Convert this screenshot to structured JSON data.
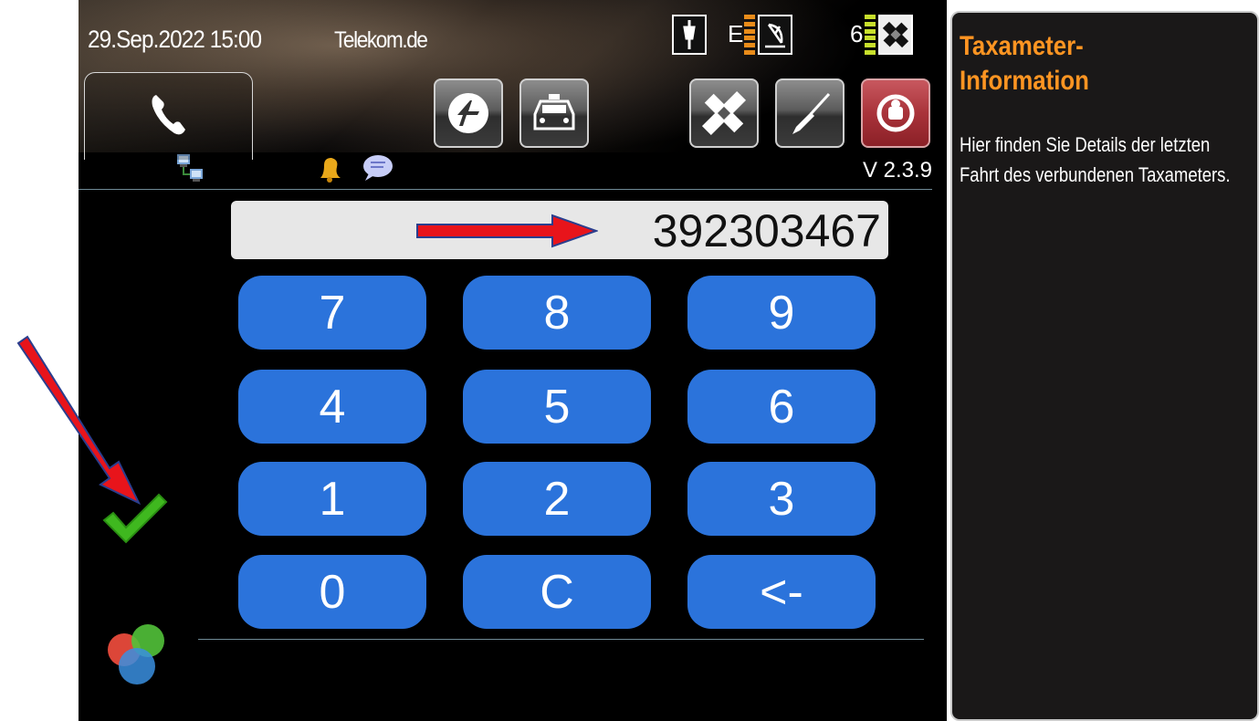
{
  "status_bar": {
    "datetime": "29.Sep.2022 15:00",
    "network": "Telekom.de",
    "e_label": "E",
    "gps_count": "6"
  },
  "toolbar": {
    "phone_tab": "phone-icon",
    "buttons": [
      "dispatch-icon",
      "taxi-icon",
      "satellite-icon",
      "tools-icon",
      "logout-icon"
    ]
  },
  "info_row": {
    "version": "V 2.3.9"
  },
  "keypad": {
    "display_value": "392303467",
    "keys": [
      "7",
      "8",
      "9",
      "4",
      "5",
      "6",
      "1",
      "2",
      "3",
      "0",
      "C",
      "<-"
    ]
  },
  "side_panel": {
    "title": "Taxameter-Information",
    "body": "Hier finden Sie Details der letzten Fahrt des verbundenen Taxameters."
  },
  "colors": {
    "key_blue": "#2b73db",
    "title_orange": "#ff9522",
    "arrow_red": "#e8141b",
    "check_green": "#3fb81f"
  }
}
